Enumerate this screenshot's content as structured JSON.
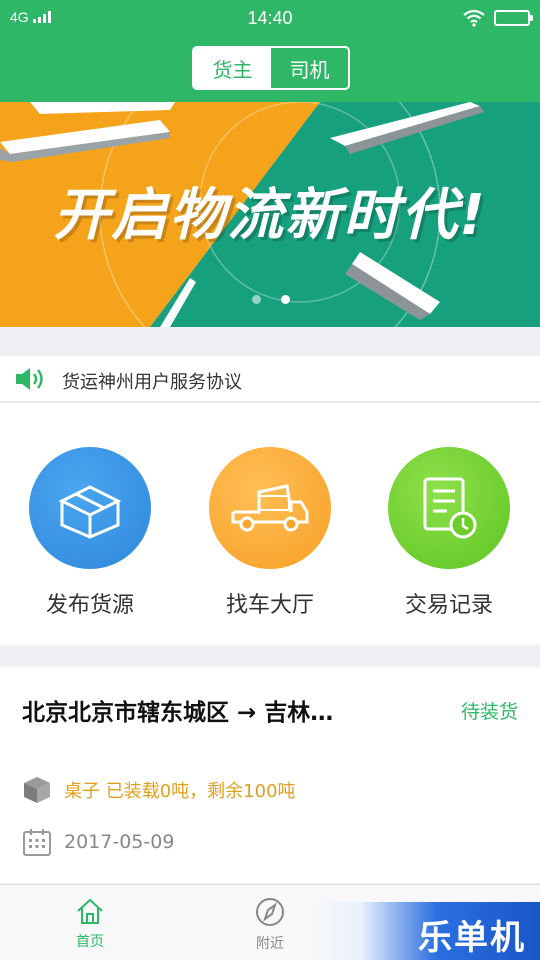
{
  "status_bar": {
    "network": "4G",
    "time": "14:40"
  },
  "header": {
    "segments": [
      "货主",
      "司机"
    ],
    "active_segment": "货主"
  },
  "banner": {
    "headline": "开启物流新时代!",
    "page_count": 2,
    "current_page": 2,
    "colors": {
      "left": "#f5a31a",
      "right": "#17a07e"
    }
  },
  "notice": {
    "icon": "speaker-icon",
    "text": "货运神州用户服务协议"
  },
  "menu": {
    "items": [
      {
        "label": "发布货源",
        "icon": "box-icon",
        "color": "#2f8fe0"
      },
      {
        "label": "找车大厅",
        "icon": "truck-icon",
        "color": "#f7a52c"
      },
      {
        "label": "交易记录",
        "icon": "record-icon",
        "color": "#6ccd2b"
      }
    ]
  },
  "order": {
    "route": "北京北京市辖东城区 → 吉林…",
    "status": "待装货",
    "goods": "桌子 已装载0吨，剩余100吨",
    "date": "2017-05-09"
  },
  "tabbar": {
    "tabs": [
      {
        "label": "首页",
        "icon": "home-icon",
        "active": true
      },
      {
        "label": "附近",
        "icon": "compass-icon",
        "active": false
      }
    ]
  },
  "watermark": {
    "text": "乐单机"
  },
  "colors": {
    "primary": "#2fb768",
    "accent_orange": "#e0a020"
  }
}
